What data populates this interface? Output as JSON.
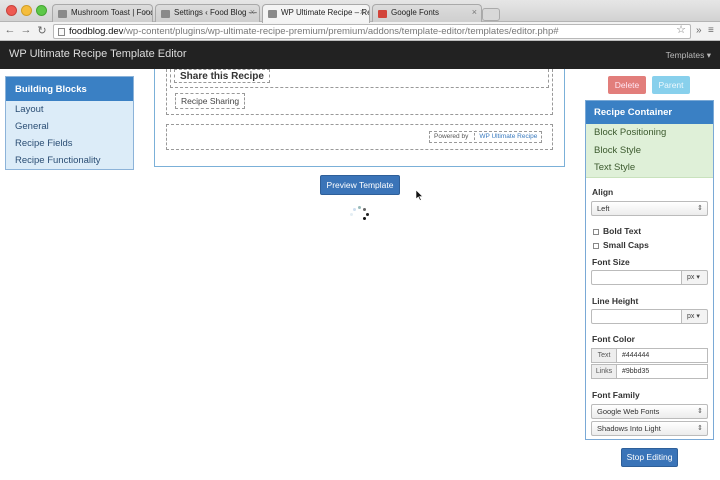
{
  "browser": {
    "tabs": [
      {
        "label": "Mushroom Toast | Food Bl",
        "active": false
      },
      {
        "label": "Settings ‹ Food Blog — Wo",
        "active": false
      },
      {
        "label": "WP Ultimate Recipe – Reci",
        "active": true
      },
      {
        "label": "Google Fonts",
        "active": false
      }
    ],
    "url_host": "foodblog.dev",
    "url_path": "/wp-content/plugins/wp-ultimate-recipe-premium/premium/addons/template-editor/templates/editor.php#"
  },
  "adminbar": {
    "title": "WP Ultimate Recipe Template Editor",
    "menu": "Templates ▾"
  },
  "sidebar": {
    "heading": "Building Blocks",
    "items": [
      "Layout",
      "General",
      "Recipe Fields",
      "Recipe Functionality"
    ]
  },
  "canvas": {
    "share_title": "Share this Recipe",
    "share_button": "Recipe Sharing",
    "powered_by": "Powered by",
    "powered_link": "WP Ultimate Recipe",
    "preview_button": "Preview Template"
  },
  "actions": {
    "delete": "Delete",
    "parent": "Parent"
  },
  "properties": {
    "heading": "Recipe Container",
    "sections": [
      "Block Positioning",
      "Block Style",
      "Text Style"
    ],
    "align": {
      "label": "Align",
      "value": "Left"
    },
    "bold_text": {
      "label": "Bold Text",
      "checked": false
    },
    "small_caps": {
      "label": "Small Caps",
      "checked": false
    },
    "font_size": {
      "label": "Font Size",
      "value": "",
      "unit": "px"
    },
    "line_height": {
      "label": "Line Height",
      "value": "",
      "unit": "px"
    },
    "font_color": {
      "label": "Font Color",
      "text_label": "Text",
      "text_value": "#444444",
      "links_label": "Links",
      "links_value": "#9bbd35"
    },
    "font_family": {
      "label": "Font Family",
      "source": "Google Web Fonts",
      "font": "Shadows Into Light"
    },
    "stop_button": "Stop Editing"
  },
  "colors": {
    "accent_blue": "#3a80c4",
    "admin_bar": "#222222",
    "delete_red": "#d9534f",
    "parent_cyan": "#6bc5e8",
    "section_green": "#dff0d8"
  }
}
